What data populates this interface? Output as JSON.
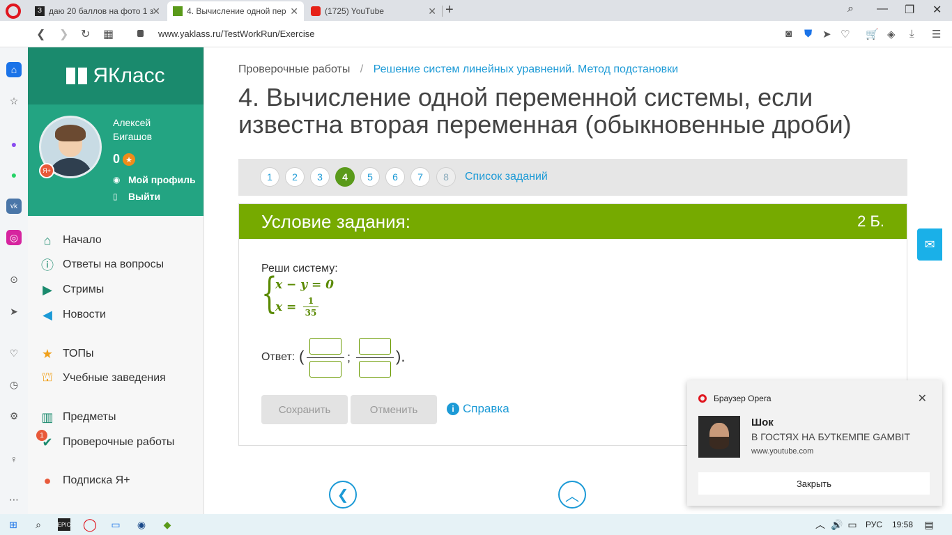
{
  "browser": {
    "tabs": [
      {
        "title": "даю 20 баллов на фото 1 за",
        "favicon": "znanija-favicon"
      },
      {
        "title": "4. Вычисление одной пер",
        "favicon": "yaklass-favicon",
        "active": true
      },
      {
        "title": "(1725) YouTube",
        "favicon": "youtube-favicon"
      }
    ],
    "url": "www.yaklass.ru/TestWorkRun/Exercise",
    "new_tab": "+"
  },
  "site": {
    "logo_text": "ЯКласс",
    "user": {
      "name": "Алексей Бигашов",
      "score": "0",
      "profile_link": "Мой профиль",
      "logout_link": "Выйти",
      "badge": "Я+"
    },
    "menu": [
      {
        "label": "Начало",
        "icon": "home-icon"
      },
      {
        "label": "Ответы на вопросы",
        "icon": "question-icon"
      },
      {
        "label": "Стримы",
        "icon": "stream-icon"
      },
      {
        "label": "Новости",
        "icon": "news-icon"
      },
      {
        "label": "ТОПы",
        "icon": "star-icon"
      },
      {
        "label": "Учебные заведения",
        "icon": "school-icon"
      },
      {
        "label": "Предметы",
        "icon": "books-icon"
      },
      {
        "label": "Проверочные работы",
        "icon": "check-icon",
        "badge": "1"
      },
      {
        "label": "Подписка Я+",
        "icon": "subscription-icon"
      }
    ]
  },
  "main": {
    "breadcrumbs": [
      "Проверочные работы",
      "Решение систем линейных уравнений. Метод подстановки"
    ],
    "breadcrumb_sep": "/",
    "title": "4. Вычисление одной переменной системы, если известна вторая переменная (обыкновенные дроби)",
    "pager": {
      "pages": [
        "1",
        "2",
        "3",
        "4",
        "5",
        "6",
        "7",
        "8"
      ],
      "active": "4",
      "list_link": "Список заданий"
    },
    "task": {
      "header": "Условие задания:",
      "points": "2 Б.",
      "prompt": "Реши систему:",
      "eq1": "x − y = 0",
      "eq2_lhs": "x =",
      "eq2_num": "1",
      "eq2_den": "35",
      "answer_label": "Ответ:",
      "open_paren": "(",
      "semicolon": ";",
      "close_paren": ").",
      "save_button": "Сохранить",
      "cancel_button": "Отменить",
      "help_link": "Справка"
    }
  },
  "notification": {
    "source": "Браузер Opera",
    "title": "Шок",
    "subtitle": "В ГОСТЯХ НА БУТКЕМПЕ GAMBIT",
    "url": "www.youtube.com",
    "close_button": "Закрыть"
  },
  "taskbar": {
    "language": "РУС",
    "time": "19:58"
  }
}
